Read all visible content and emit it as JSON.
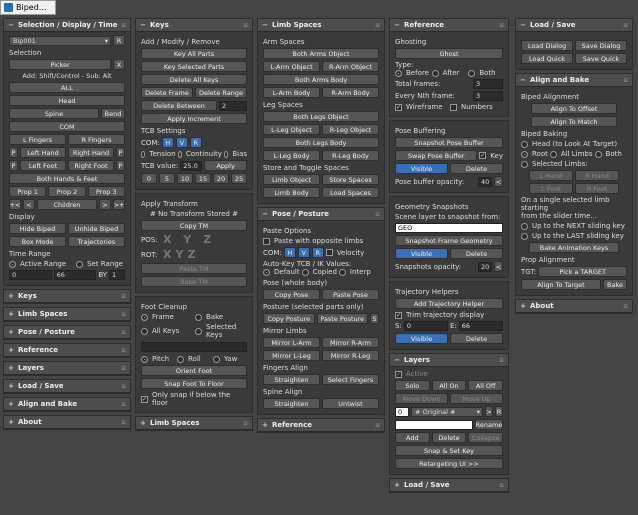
{
  "window": {
    "title": "Biped..."
  },
  "col1": {
    "sel_head": "Selection / Display / Time",
    "biped_select": "Bip001",
    "r": "R",
    "selection_lbl": "Selection",
    "picker": "Picker",
    "x": "X",
    "add_hint": "Add: Shift/Control - Sub: Alt",
    "all": "ALL",
    "head": "Head",
    "spine": "Spine",
    "bend": "Bend",
    "com": "COM",
    "lfingers": "L Fingers",
    "rfingers": "R Fingers",
    "p": "P",
    "lhand": "Left Hand",
    "rhand": "Right Hand",
    "lfoot": "Left Foot",
    "rfoot": "Right Foot",
    "bothhf": "Both Hands & Feet",
    "prop1": "Prop 1",
    "prop2": "Prop 2",
    "prop3": "Prop 3",
    "pp": "+<",
    "lt": "<",
    "children": "Children",
    "gt": ">",
    "gp": ">+",
    "display_lbl": "Display",
    "hide": "Hide Biped",
    "unhide": "Unhide Biped",
    "boxmode": "Box Mode",
    "traj": "Trajectories",
    "time_lbl": "Time Range",
    "active": "Active Range",
    "setrange": "Set Range",
    "t0": "0",
    "t1": "66",
    "by": "BY",
    "t2": "1",
    "collapsed": [
      "Keys",
      "Limb Spaces",
      "Pose / Posture",
      "Reference",
      "Layers",
      "Load / Save",
      "Align and Bake",
      "About"
    ]
  },
  "col2": {
    "keys_head": "Keys",
    "add_lbl": "Add / Modify / Remove",
    "keyall": "Key All Parts",
    "keysel": "Key Selected Parts",
    "delall": "Delete All Keys",
    "delframe": "Delete Frame",
    "delrange": "Delete Range",
    "delbetween": "Delete Between",
    "db": "2",
    "applyinc": "Apply Increment",
    "tcb_lbl": "TCB Settings",
    "com": "COM:",
    "h": "H",
    "v": "V",
    "rb": "R",
    "tension": "Tension",
    "continuity": "Continuity",
    "bias": "Bias",
    "tcbval": "TCB value:",
    "tcbnum": "25.0",
    "apply": "Apply",
    "nums": [
      "0",
      "5",
      "10",
      "15",
      "20",
      "25"
    ],
    "at_lbl": "Apply Transform",
    "nostored": "# No Transform Stored #",
    "copytm": "Copy TM",
    "pos": "POS:",
    "rot": "ROT:",
    "xyz1": "X Y Z",
    "xyz2": "XYZ",
    "pastetm": "Paste TM",
    "baketm": "Bake TM",
    "fc_lbl": "Foot Cleanup",
    "frame": "Frame",
    "bake": "Bake",
    "allkeys": "All Keys",
    "selkeys": "Selected Keys",
    "pitch": "Pitch",
    "roll": "Roll",
    "yaw": "Yaw",
    "orient": "Orient Foot",
    "snap": "Snap Foot To Floor",
    "onlysnap": "Only snap if below the floor",
    "limb_collapsed": "Limb Spaces"
  },
  "col3": {
    "ls_head": "Limb Spaces",
    "arm_lbl": "Arm Spaces",
    "botharmsobj": "Both Arms Object",
    "larmobj": "L-Arm Object",
    "rarmobj": "R-Arm Object",
    "botharmsbody": "Both Arms Body",
    "larmbody": "L-Arm Body",
    "rarmbody": "R-Arm Body",
    "leg_lbl": "Leg Spaces",
    "bothlegsobj": "Both Legs Object",
    "llegobj": "L-Leg Object",
    "rlegobj": "R-Leg Object",
    "bothlegsbody": "Both Legs Body",
    "llegbody": "L-Leg Body",
    "rlegbody": "R-Leg Body",
    "store_lbl": "Store and Toggle Spaces",
    "limbobj": "Limb Object",
    "storesp": "Store Spaces",
    "limbbody": "Limb Body",
    "loadsp": "Load Spaces",
    "pp_head": "Pose / Posture",
    "paste_lbl": "Paste Options",
    "pasteopp": "Paste with opposite limbs",
    "com": "COM:",
    "h": "H",
    "v": "V",
    "r": "R",
    "vel": "Velocity",
    "autokey": "Auto-Key TCB / IK Values:",
    "default": "Default",
    "copied": "Copied",
    "interp": "Interp",
    "pose_lbl": "Pose (whole body)",
    "copypose": "Copy Pose",
    "pastepose": "Paste Pose",
    "posture_lbl": "Posture (selected parts only)",
    "copypost": "Copy Posture",
    "pastepost": "Paste Posture",
    "s": "S",
    "mirror_lbl": "Mirror Limbs",
    "mla": "Mirror L-Arm",
    "mra": "Mirror R-Arm",
    "mll": "Mirror L-Leg",
    "mrl": "Mirror R-Leg",
    "fa_lbl": "Fingers Align",
    "straighten": "Straighten",
    "selfingers": "Select Fingers",
    "sa_lbl": "Spine Align",
    "straighten2": "Straighten",
    "untwist": "Untwist",
    "ref_collapsed": "Reference"
  },
  "col4": {
    "ref_head": "Reference",
    "ghost_lbl": "Ghosting",
    "ghost": "Ghost",
    "type": "Type:",
    "before": "Before",
    "after": "After",
    "both": "Both",
    "totalframes": "Total frames:",
    "tf": "3",
    "everynth": "Every Nth frame:",
    "en": "3",
    "wire": "Wireframe",
    "numbers": "Numbers",
    "pb_lbl": "Pose Buffering",
    "snapbuf": "Snapshot Pose Buffer",
    "swapbuf": "Swap Pose Buffer",
    "key": "Key",
    "visible": "Visible",
    "delete": "Delete",
    "opacity": "Pose buffer opacity:",
    "op": "40",
    "gs_lbl": "Geometry Snapshots",
    "scene": "Scene layer to snapshot from:",
    "geo": "GEO",
    "snapgeo": "Snapshot Frame Geometry",
    "visible2": "Visible",
    "delete2": "Delete",
    "snapop": "Snapshots opacity:",
    "sop": "20",
    "th_lbl": "Trajectory Helpers",
    "addtraj": "Add Trajectory Helper",
    "trim": "Trim trajectory display",
    "s": "S:",
    "sv": "0",
    "e": "E:",
    "ev": "66",
    "visible3": "Visible",
    "delete3": "Delete",
    "layers_head": "Layers",
    "active": "Active",
    "solo": "Solo",
    "allon": "All On",
    "alloff": "All Off",
    "movedown": "Move Down",
    "moveup": "Move Up",
    "layerno": "0",
    "layername": "# Original #",
    "rename": "Rename",
    "add": "Add",
    "del": "Delete",
    "collapse": "Collapse",
    "snapset": "Snap & Set Key",
    "retarget": "Retargeting UI  >>",
    "load_collapsed": "Load / Save"
  },
  "col5": {
    "ls_head": "Load / Save",
    "loaddialog": "Load Dialog",
    "savedialog": "Save Dialog",
    "loadquick": "Load Quick",
    "savequick": "Save Quick",
    "ab_head": "Align and Bake",
    "ba_lbl": "Biped Alignment",
    "alignoff": "Align To Offset",
    "alignmatch": "Align To Match",
    "bb_lbl": "Biped Baking",
    "headlook": "Head (to Look At Target)",
    "root": "Root",
    "alllimbs": "All Limbs",
    "both": "Both",
    "sellimbs": "Selected Limbs:",
    "lhand": "L Hand",
    "rhand": "R Hand",
    "lfoot": "L Foot",
    "rfoot": "R Foot",
    "onsingle": "On a single selected limb starting",
    "from": "from the slider time...",
    "nextkey": "Up to the NEXT sliding key",
    "lastkey": "Up to the LAST sliding key",
    "bakeanim": "Bake Animation Keys",
    "pa_lbl": "Prop Alignment",
    "tgt": "TGT:",
    "pick": "Pick a TARGET",
    "aligntgt": "Align To Target",
    "bake": "Bake",
    "about_collapsed": "About"
  }
}
